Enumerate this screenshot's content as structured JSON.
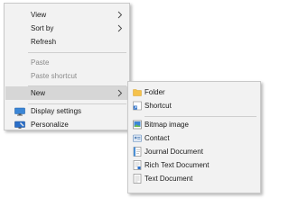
{
  "context_menu": {
    "view": "View",
    "sort_by": "Sort by",
    "refresh": "Refresh",
    "paste": "Paste",
    "paste_shortcut": "Paste shortcut",
    "new": "New",
    "display_settings": "Display settings",
    "personalize": "Personalize"
  },
  "new_submenu": {
    "folder": "Folder",
    "shortcut": "Shortcut",
    "bitmap": "Bitmap image",
    "contact": "Contact",
    "journal": "Journal Document",
    "rtf": "Rich Text Document",
    "text": "Text Document"
  },
  "icons": {
    "folder": "folder-icon",
    "shortcut": "shortcut-icon",
    "bitmap": "bitmap-image-icon",
    "contact": "contact-icon",
    "journal": "journal-document-icon",
    "rtf": "rich-text-document-icon",
    "text": "text-document-icon",
    "display": "display-settings-icon",
    "personalize": "personalize-icon"
  },
  "colors": {
    "menu_bg": "#f2f2f2",
    "highlight": "#d6d6d6",
    "disabled_text": "#8a8a8a",
    "folder": "#f5c24b",
    "accent_blue": "#2a6fc9"
  }
}
